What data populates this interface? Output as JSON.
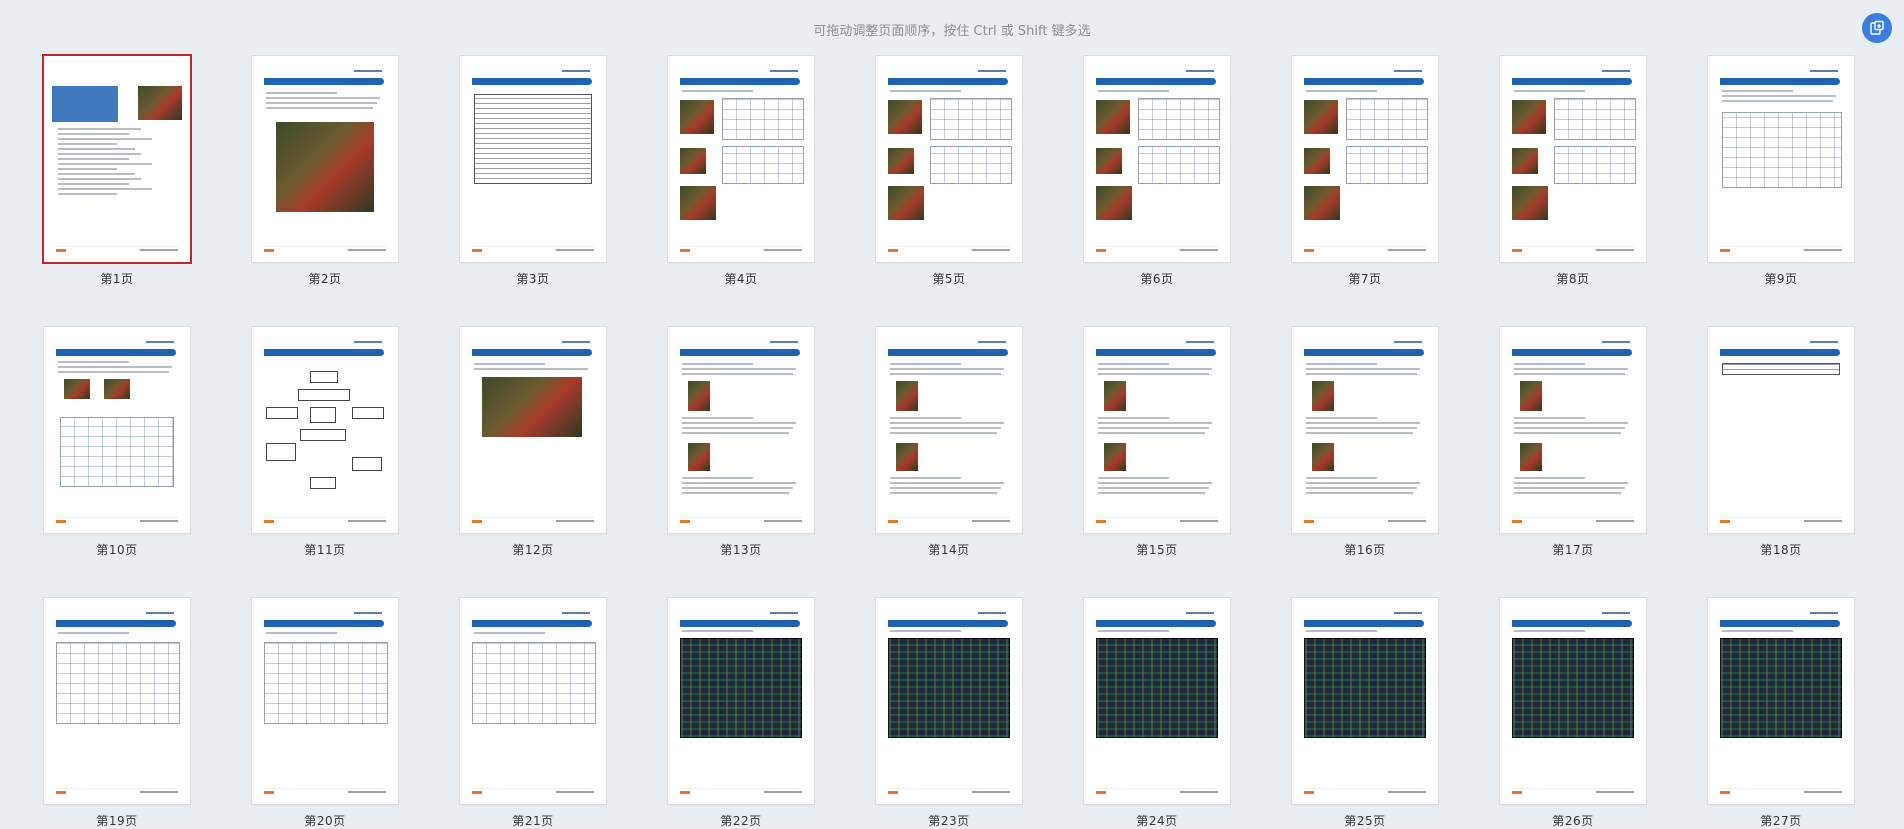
{
  "hint": "可拖动调整页面顺序，按住 Ctrl 或 Shift 键多选",
  "corner_button_icon": "export-icon",
  "accent": "#3b7ddd",
  "selected_border": "#c6232e",
  "pages": [
    {
      "label": "第1页",
      "kind": "cover",
      "selected": true
    },
    {
      "label": "第2页",
      "kind": "board"
    },
    {
      "label": "第3页",
      "kind": "table"
    },
    {
      "label": "第4页",
      "kind": "photo-schem"
    },
    {
      "label": "第5页",
      "kind": "photo-schem"
    },
    {
      "label": "第6页",
      "kind": "photo-schem"
    },
    {
      "label": "第7页",
      "kind": "photo-schem"
    },
    {
      "label": "第8页",
      "kind": "photo-schem"
    },
    {
      "label": "第9页",
      "kind": "diagram"
    },
    {
      "label": "第10页",
      "kind": "screenshot"
    },
    {
      "label": "第11页",
      "kind": "flow"
    },
    {
      "label": "第12页",
      "kind": "photo-only"
    },
    {
      "label": "第13页",
      "kind": "steps"
    },
    {
      "label": "第14页",
      "kind": "steps"
    },
    {
      "label": "第15页",
      "kind": "steps"
    },
    {
      "label": "第16页",
      "kind": "steps"
    },
    {
      "label": "第17页",
      "kind": "steps"
    },
    {
      "label": "第18页",
      "kind": "small-table"
    },
    {
      "label": "第19页",
      "kind": "schematic"
    },
    {
      "label": "第20页",
      "kind": "schematic"
    },
    {
      "label": "第21页",
      "kind": "schematic"
    },
    {
      "label": "第22页",
      "kind": "pcb"
    },
    {
      "label": "第23页",
      "kind": "pcb"
    },
    {
      "label": "第24页",
      "kind": "pcb"
    },
    {
      "label": "第25页",
      "kind": "pcb"
    },
    {
      "label": "第26页",
      "kind": "pcb"
    },
    {
      "label": "第27页",
      "kind": "pcb"
    }
  ]
}
